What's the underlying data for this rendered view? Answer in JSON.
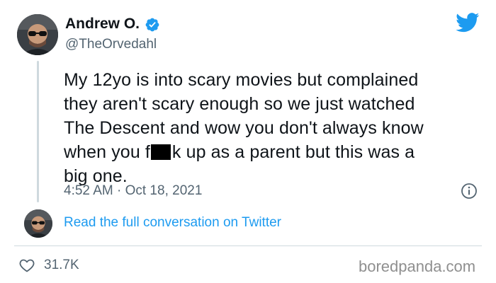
{
  "author": {
    "name": "Andrew O.",
    "handle": "@TheOrvedahl",
    "verified": true
  },
  "tweet": {
    "lines": [
      "My 12yo is into scary movies but complained",
      "they aren't scary enough so we just watched",
      "The Descent and wow you don't always know",
      {
        "before": "when you f",
        "after": "k up as a parent but this was a"
      },
      "big one."
    ],
    "timestamp": "4:52 AM · Oct 18, 2021"
  },
  "conversation_link": "Read the full conversation on Twitter",
  "likes": "31.7K",
  "watermark": "boredpanda.com",
  "colors": {
    "text": "#0f1419",
    "secondary": "#536471",
    "accent": "#1d9bf0",
    "divider": "#cfd9de",
    "watermark": "#8f8f8f"
  },
  "icons": {
    "brand": "twitter-bird-icon",
    "verified": "verified-badge-icon",
    "info": "info-icon",
    "like": "heart-icon"
  }
}
